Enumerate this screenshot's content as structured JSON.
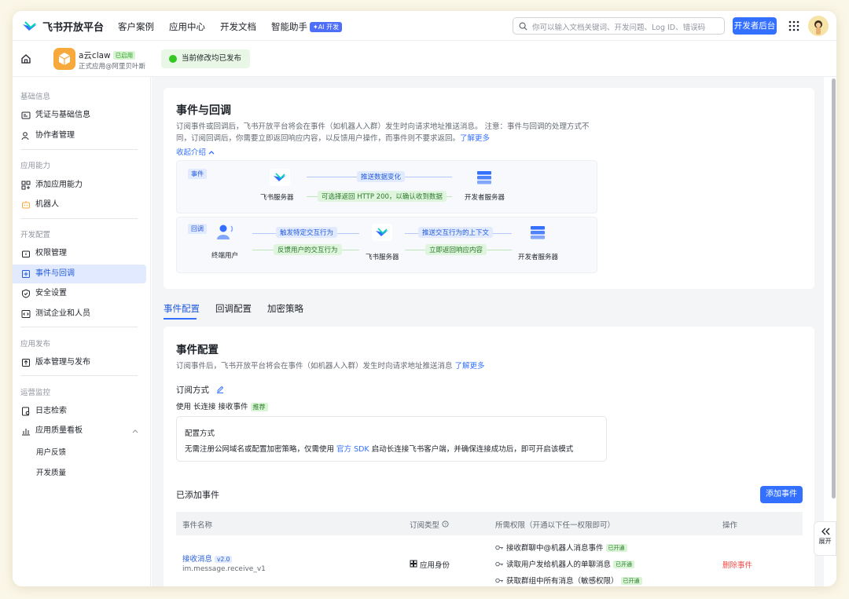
{
  "header": {
    "brand": "飞书开放平台",
    "nav": [
      "客户案例",
      "应用中心",
      "开发文档",
      "智能助手"
    ],
    "ai_badge": "✦AI 开发",
    "search_placeholder": "你可以输入文档关键词、开发问题、Log ID、错误码",
    "dev_console": "开发者后台"
  },
  "app": {
    "name": "a云claw",
    "status": "已启用",
    "subtitle": "正式应用@阿里贝叶斯",
    "publish_status": "当前修改均已发布"
  },
  "sidebar": {
    "sections": [
      {
        "title": "基础信息",
        "items": [
          "凭证与基础信息",
          "协作者管理"
        ]
      },
      {
        "title": "应用能力",
        "items": [
          "添加应用能力",
          "机器人"
        ]
      },
      {
        "title": "开发配置",
        "items": [
          "权限管理",
          "事件与回调",
          "安全设置",
          "测试企业和人员"
        ]
      },
      {
        "title": "应用发布",
        "items": [
          "版本管理与发布"
        ]
      },
      {
        "title": "运营监控",
        "items": [
          "日志检索",
          "应用质量看板"
        ]
      }
    ],
    "sub_items": [
      "用户反馈",
      "开发质量"
    ]
  },
  "intro": {
    "title": "事件与回调",
    "desc": "订阅事件或回调后，飞书开放平台将会在事件（如机器人入群）发生时向请求地址推送消息。 注意：事件与回调的处理方式不同，订阅回调后，你需要立即返回响应内容，以反馈用户操作，而事件则不要求返回。",
    "learn_more": "了解更多",
    "collapse": "收起介绍",
    "flow_event": {
      "tag": "事件",
      "from": "飞书服务器",
      "to": "开发者服务器",
      "push": "推送数据变化",
      "ack": "可选择返回 HTTP 200，以确认收到数据"
    },
    "flow_callback": {
      "tag": "回调",
      "user": "终端用户",
      "server": "飞书服务器",
      "dev": "开发者服务器",
      "trigger": "触发特定交互行为",
      "feedback": "反馈用户的交互行为",
      "push_ctx": "推送交互行为的上下文",
      "reply": "立即返回响应内容"
    }
  },
  "tabs": [
    "事件配置",
    "回调配置",
    "加密策略"
  ],
  "event_config": {
    "title": "事件配置",
    "desc": "订阅事件后，飞书开放平台将会在事件（如机器人入群）发生时向请求地址推送消息",
    "learn_more": "了解更多",
    "sub_title": "订阅方式",
    "sub_mode": "使用 长连接 接收事件",
    "recommended": "推荐",
    "cfg_title": "配置方式",
    "cfg_desc_1": "无需注册公网域名或配置加密策略，仅需使用",
    "cfg_link": "官方 SDK",
    "cfg_desc_2": "启动长连接飞书客户端，并确保连接成功后，即可开启该模式",
    "added_title": "已添加事件",
    "add_button": "添加事件",
    "columns": [
      "事件名称",
      "订阅类型",
      "所需权限（开通以下任一权限即可）",
      "操作"
    ],
    "row": {
      "name": "接收消息",
      "version": "v2.0",
      "key": "im.message.receive_v1",
      "type": "应用身份",
      "perms": [
        "接收群聊中@机器人消息事件",
        "读取用户发给机器人的单聊消息",
        "获取群组中所有消息（敏感权限）"
      ],
      "perm_status": "已开通",
      "action": "删除事件"
    }
  },
  "expand_label": "展开"
}
